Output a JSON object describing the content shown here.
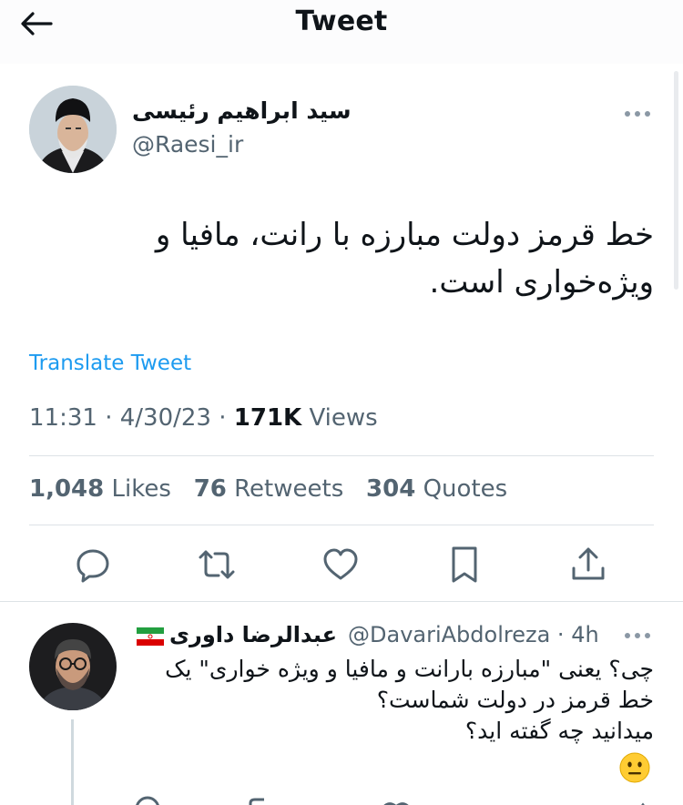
{
  "header": {
    "title": "Tweet",
    "back_icon": "arrow-left-icon"
  },
  "tweet": {
    "author_name": "سید ابراهیم رئیسی",
    "author_handle": "@Raesi_ir",
    "text_line1": "خط قرمز دولت مبارزه با رانت، مافیا و",
    "text_line2": "ویژه‌خواری است.",
    "translate_label": "Translate Tweet",
    "time": "11:31",
    "date": "4/30/23",
    "views_count": "171K",
    "views_label": "Views",
    "likes_count": "1,048",
    "likes_label": "Likes",
    "retweets_count": "76",
    "retweets_label": "Retweets",
    "quotes_count": "304",
    "quotes_label": "Quotes",
    "actions": [
      "reply-icon",
      "retweet-icon",
      "like-icon",
      "bookmark-icon",
      "share-icon"
    ]
  },
  "reply": {
    "author_name": "عبدالرضا داوری",
    "author_handle": "@DavariAbdolreza",
    "age": "4h",
    "line1": "چی؟ یعنی \"مبارزه بارانت و مافیا و ویژه خواری\" یک",
    "line2": "خط قرمز در دولت شماست؟",
    "line3": "میدانید چه گفته اید؟",
    "emoji": "neutral-face-emoji"
  },
  "colors": {
    "link": "#1d9bf0",
    "muted": "#536471",
    "text": "#0f1419",
    "divider": "#dde2e6"
  }
}
